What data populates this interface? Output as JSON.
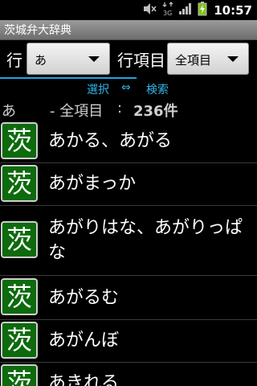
{
  "status_bar": {
    "time": "10:57",
    "icons": [
      "mute-icon",
      "3g-data-icon",
      "signal-icon",
      "battery-charging-icon"
    ]
  },
  "app": {
    "title": "茨城弁大辞典"
  },
  "filter": {
    "row_label": "行",
    "row_value": "あ",
    "item_label": "行項目",
    "item_value": "全項目"
  },
  "tabs": {
    "select": "選択",
    "arrow": "⇔",
    "search": "検索"
  },
  "summary": {
    "letter": "あ",
    "desc": "- 全項目",
    "colon": ":",
    "count": "236件"
  },
  "badge_char": "茨",
  "list": [
    {
      "word": "あかる、あがる"
    },
    {
      "word": "あがまっか"
    },
    {
      "word": "あがりはな、あがりっぱな"
    },
    {
      "word": "あがるむ"
    },
    {
      "word": "あがんぼ"
    },
    {
      "word": "あきれる"
    }
  ],
  "colors": {
    "accent": "#33b5e5",
    "badge_green": "#0d6a0d",
    "title_bar": "#8a8a8a",
    "background": "#000000"
  }
}
